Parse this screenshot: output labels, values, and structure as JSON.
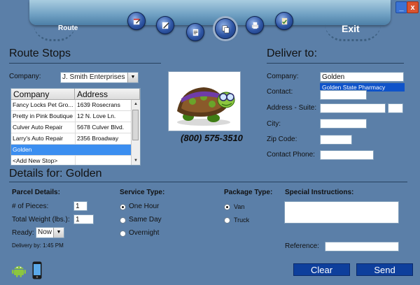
{
  "window": {
    "minimize_label": "_",
    "close_label": "x"
  },
  "toolbar": {
    "route_label": "Route",
    "exit_label": "Exit",
    "buttons": [
      {
        "icon": "calendar-edit-icon"
      },
      {
        "icon": "pencil-edit-icon"
      },
      {
        "icon": "note-edit-icon"
      },
      {
        "icon": "copy-document-icon"
      },
      {
        "icon": "printer-icon"
      },
      {
        "icon": "clipboard-check-icon"
      }
    ]
  },
  "route_stops": {
    "title": "Route Stops",
    "company_label": "Company:",
    "company_value": "J. Smith Enterprises",
    "columns": [
      "Company",
      "Address"
    ],
    "rows": [
      {
        "company": "Fancy Locks Pet Gro...",
        "address": "1639 Rosecrans"
      },
      {
        "company": "Pretty in Pink Boutique",
        "address": "12 N. Love Ln."
      },
      {
        "company": "Culver Auto Repair",
        "address": "5678 Culver Blvd."
      },
      {
        "company": "Larry's Auto Repair",
        "address": "2356 Broadway"
      },
      {
        "company": "Golden",
        "address": "",
        "selected": true
      },
      {
        "company": "<Add New Stop>",
        "address": ""
      }
    ]
  },
  "brand": {
    "phone": "(800) 575-3510",
    "logo_icon": "turtle-mascot-icon"
  },
  "deliver_to": {
    "title": "Deliver to:",
    "company_label": "Company:",
    "company_value": "Golden",
    "suggestion": "Golden State Pharmacy",
    "contact_label": "Contact:",
    "address_label": "Address - Suite:",
    "city_label": "City:",
    "zip_label": "Zip Code:",
    "phone_label": "Contact Phone:"
  },
  "details": {
    "title": "Details for: Golden",
    "parcel_title": "Parcel Details:",
    "pieces_label": "# of Pieces:",
    "pieces_value": "1",
    "weight_label": "Total Weight (lbs.):",
    "weight_value": "1",
    "ready_label": "Ready:",
    "ready_value": "Now",
    "delivery_by": "Delivery by: 1:45 PM",
    "service_title": "Service Type:",
    "service_options": [
      "One Hour",
      "Same Day",
      "Overnight"
    ],
    "service_selected": 0,
    "package_title": "Package Type:",
    "package_options": [
      "Van",
      "Truck"
    ],
    "package_selected": 0,
    "special_title": "Special Instructions:",
    "reference_label": "Reference:"
  },
  "footer": {
    "clear_label": "Clear",
    "send_label": "Send",
    "android_icon": "android-icon",
    "phone_icon": "mobile-phone-icon"
  },
  "colors": {
    "background": "#5b7fa8",
    "button": "#0e3f9c",
    "selection": "#3b8ef0",
    "suggestion": "#0f53c9"
  }
}
